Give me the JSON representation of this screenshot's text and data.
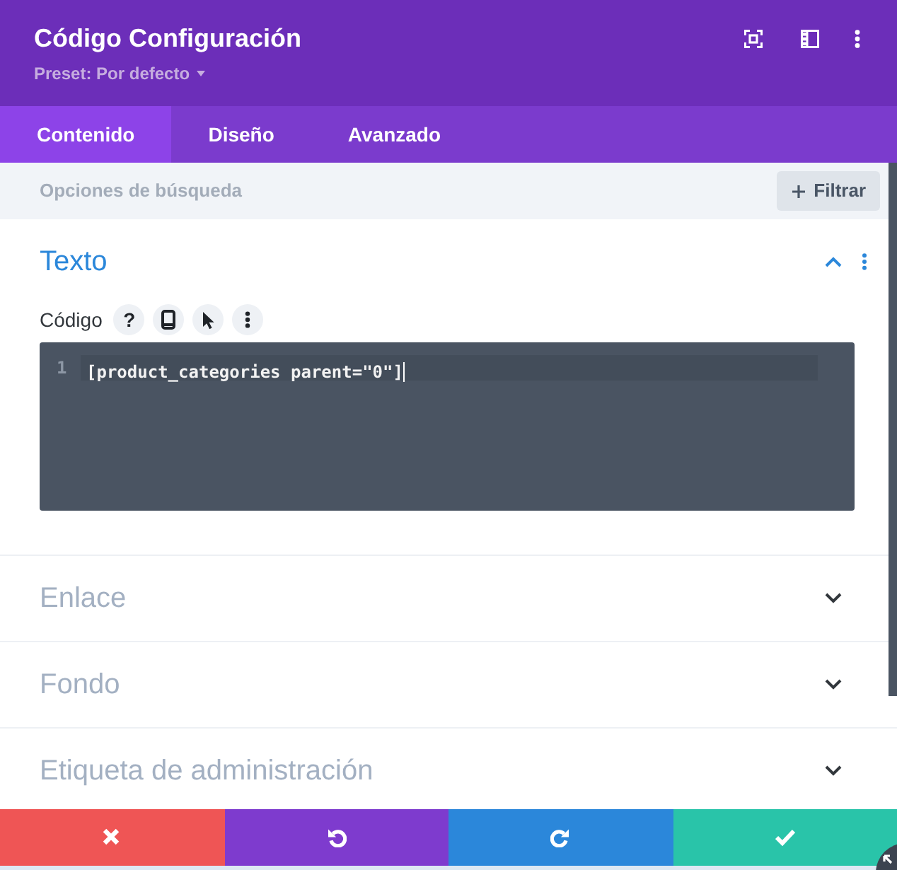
{
  "header": {
    "title": "Código Configuración",
    "preset": "Preset: Por defecto"
  },
  "tabs": [
    {
      "label": "Contenido",
      "selected": true
    },
    {
      "label": "Diseño",
      "selected": false
    },
    {
      "label": "Avanzado",
      "selected": false
    }
  ],
  "search": {
    "placeholder": "Opciones de búsqueda",
    "filter_button": "Filtrar"
  },
  "sections": [
    {
      "title": "Texto",
      "expanded": true,
      "field": {
        "label": "Código",
        "help": "?",
        "code_lines": [
          {
            "number": "1",
            "text": "[product_categories parent=\"0\"]",
            "active": true
          }
        ]
      }
    },
    {
      "title": "Enlace",
      "expanded": false
    },
    {
      "title": "Fondo",
      "expanded": false
    },
    {
      "title": "Etiqueta de administración",
      "expanded": false
    }
  ]
}
